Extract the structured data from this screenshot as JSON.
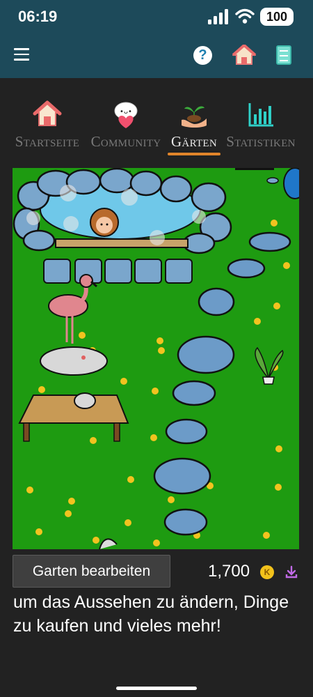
{
  "status": {
    "time": "06:19",
    "battery": "100"
  },
  "tabs": [
    {
      "label": "Startseite",
      "icon": "house-icon",
      "active": false
    },
    {
      "label": "Community",
      "icon": "face-heart-icon",
      "active": false
    },
    {
      "label": "Gärten",
      "icon": "plant-hand-icon",
      "active": true
    },
    {
      "label": "Statistiken",
      "icon": "bar-chart-icon",
      "active": false
    }
  ],
  "garden": {
    "objects": [
      "hot-spring-pool",
      "character-in-pool",
      "stepping-stones",
      "flamingo",
      "seal",
      "wooden-table",
      "small-seal",
      "potted-plant",
      "blue-creature",
      "flowers"
    ]
  },
  "footer": {
    "edit_button": "Garten bearbeiten",
    "coins": "1,700",
    "coin_symbol": "K",
    "description": "um das Aussehen zu ändern, Dinge zu kaufen und vieles mehr!"
  },
  "colors": {
    "header": "#1d4a5a",
    "background": "#222222",
    "grass": "#1e9b11",
    "accent": "#e1852a"
  }
}
